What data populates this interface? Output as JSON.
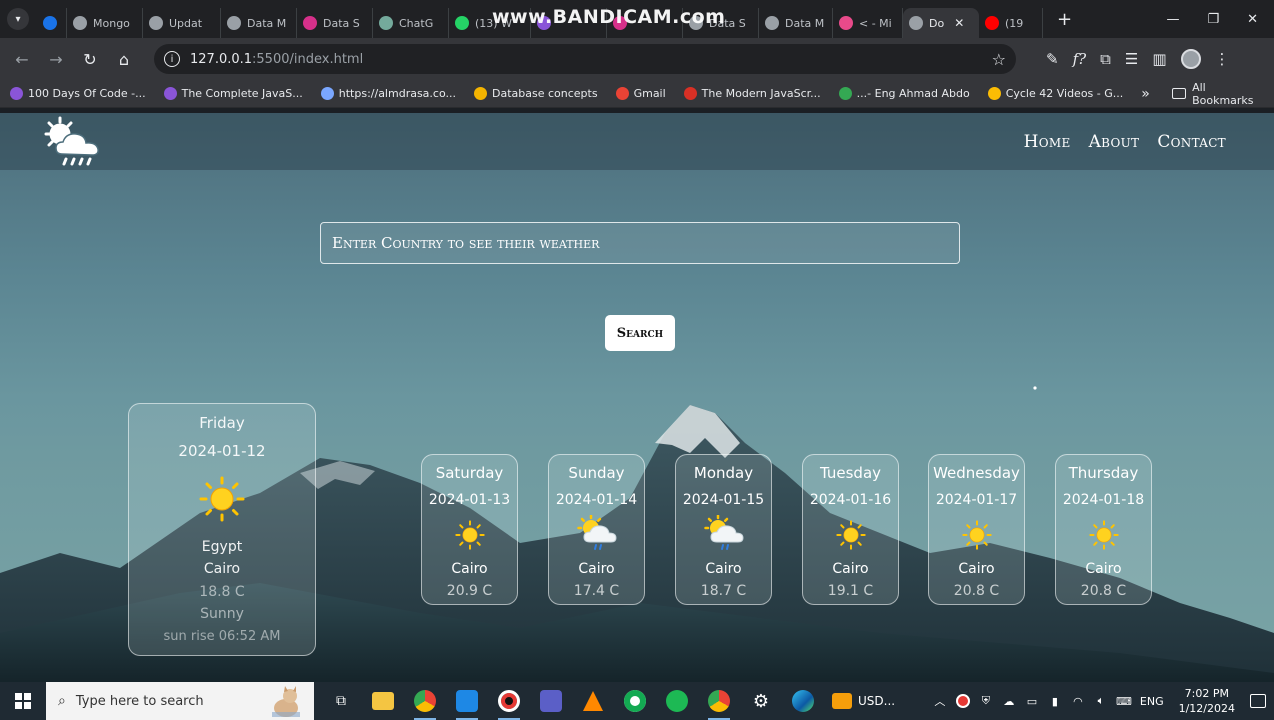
{
  "browser": {
    "watermark": "www.BANDICAM.com",
    "tabs": [
      {
        "label": "",
        "color": "#1a73e8"
      },
      {
        "label": "Mongo",
        "color": "#9aa0a6"
      },
      {
        "label": "Updat",
        "color": "#9aa0a6"
      },
      {
        "label": "Data M",
        "color": "#9aa0a6"
      },
      {
        "label": "Data S",
        "color": "#d6308a"
      },
      {
        "label": "ChatG",
        "color": "#74aa9c"
      },
      {
        "label": "(13) W",
        "color": "#25d366"
      },
      {
        "label": "",
        "color": "#8a55d8"
      },
      {
        "label": "",
        "color": "#d6308a"
      },
      {
        "label": "Data S",
        "color": "#9aa0a6"
      },
      {
        "label": "Data M",
        "color": "#9aa0a6"
      },
      {
        "label": "< - Mi",
        "color": "#e84a8a"
      },
      {
        "label": "Do",
        "color": "#9aa0a6",
        "active": true
      },
      {
        "label": "(19",
        "color": "#ff0000"
      }
    ],
    "new_tab_label": "+",
    "url_host": "127.0.0.1",
    "url_path": ":5500/index.html",
    "bookmarks": [
      {
        "label": "100 Days Of Code -...",
        "color": "#8a55d8"
      },
      {
        "label": "The Complete JavaS...",
        "color": "#8a55d8"
      },
      {
        "label": "https://almdrasa.co...",
        "color": "#7aa7ff"
      },
      {
        "label": "Database concepts",
        "color": "#f4b400"
      },
      {
        "label": "Gmail",
        "color": "#ea4335"
      },
      {
        "label": "The Modern JavaScr...",
        "color": "#d93025"
      },
      {
        "label": "...- Eng Ahmad Abdo",
        "color": "#34a853"
      },
      {
        "label": "Cycle 42 Videos - G...",
        "color": "#fbbc04"
      }
    ],
    "bookmarks_more": "»",
    "all_bookmarks": "All Bookmarks"
  },
  "page": {
    "nav": {
      "home": "Home",
      "about": "About",
      "contact": "Contact"
    },
    "search_placeholder": "Enter Country to see their weather",
    "search_button": "Search",
    "today": {
      "day": "Friday",
      "date": "2024-01-12",
      "country": "Egypt",
      "city": "Cairo",
      "temp": "18.8 C",
      "condition": "Sunny",
      "sunrise": "sun rise 06:52 AM",
      "icon": "sun-icon"
    },
    "forecast": [
      {
        "day": "Saturday",
        "date": "2024-01-13",
        "city": "Cairo",
        "temp": "20.9 C",
        "icon": "sun-icon"
      },
      {
        "day": "Sunday",
        "date": "2024-01-14",
        "city": "Cairo",
        "temp": "17.4 C",
        "icon": "sun-cloud-rain-icon"
      },
      {
        "day": "Monday",
        "date": "2024-01-15",
        "city": "Cairo",
        "temp": "18.7 C",
        "icon": "sun-cloud-rain-icon"
      },
      {
        "day": "Tuesday",
        "date": "2024-01-16",
        "city": "Cairo",
        "temp": "19.1 C",
        "icon": "sun-icon"
      },
      {
        "day": "Wednesday",
        "date": "2024-01-17",
        "city": "Cairo",
        "temp": "20.8 C",
        "icon": "sun-icon"
      },
      {
        "day": "Thursday",
        "date": "2024-01-18",
        "city": "Cairo",
        "temp": "20.8 C",
        "icon": "sun-icon"
      }
    ]
  },
  "taskbar": {
    "search_placeholder": "Type here to search",
    "usd_label": "USD...",
    "language": "ENG",
    "time": "7:02 PM",
    "date": "1/12/2024"
  }
}
